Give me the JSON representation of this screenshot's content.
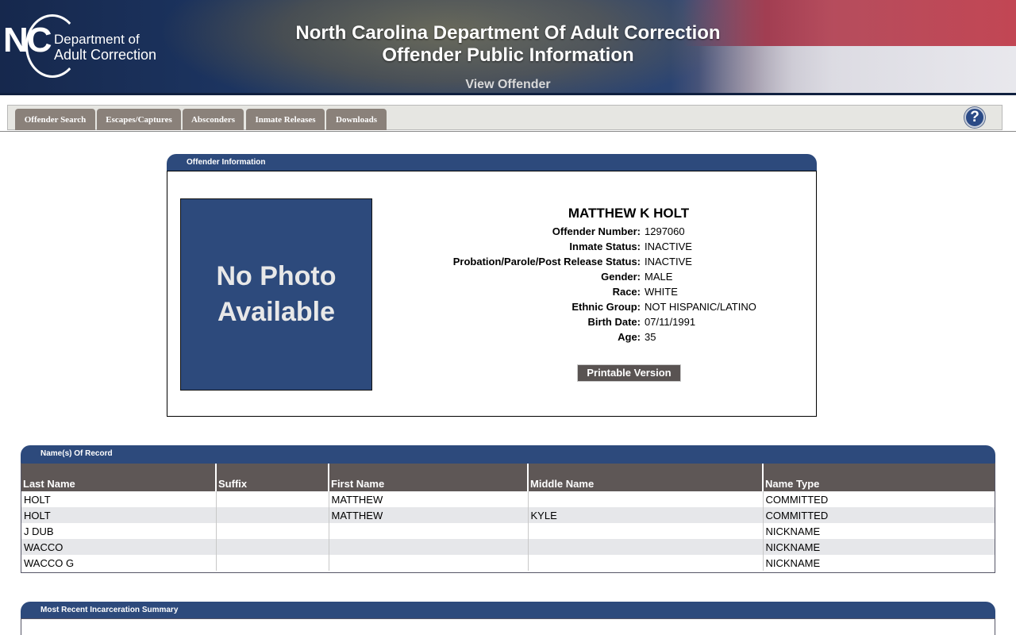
{
  "header": {
    "logo_nc": "NC",
    "logo_line1": "Department of",
    "logo_line2": "Adult Correction",
    "title_line1": "North Carolina Department Of Adult Correction",
    "title_line2": "Offender Public Information",
    "subtitle": "View Offender"
  },
  "nav": {
    "tabs": [
      "Offender Search",
      "Escapes/Captures",
      "Absconders",
      "Inmate Releases",
      "Downloads"
    ],
    "help_label": "?"
  },
  "offender_panel": {
    "heading": "Offender Information",
    "photo_placeholder": "No Photo Available",
    "name": "MATTHEW K HOLT",
    "fields": [
      {
        "label": "Offender Number:",
        "value": "1297060"
      },
      {
        "label": "Inmate Status:",
        "value": "INACTIVE"
      },
      {
        "label": "Probation/Parole/Post Release Status:",
        "value": "INACTIVE"
      },
      {
        "label": "Gender:",
        "value": "MALE"
      },
      {
        "label": "Race:",
        "value": "WHITE"
      },
      {
        "label": "Ethnic Group:",
        "value": "NOT HISPANIC/LATINO"
      },
      {
        "label": "Birth Date:",
        "value": "07/11/1991"
      },
      {
        "label": "Age:",
        "value": "35"
      }
    ],
    "print_button": "Printable Version"
  },
  "names_panel": {
    "heading": "Name(s) Of Record",
    "columns": [
      "Last Name",
      "Suffix",
      "First Name",
      "Middle Name",
      "Name Type"
    ],
    "rows": [
      [
        "HOLT",
        "",
        "MATTHEW",
        "",
        "COMMITTED"
      ],
      [
        "HOLT",
        "",
        "MATTHEW",
        "KYLE",
        "COMMITTED"
      ],
      [
        "J DUB",
        "",
        "",
        "",
        "NICKNAME"
      ],
      [
        "WACCO",
        "",
        "",
        "",
        "NICKNAME"
      ],
      [
        "WACCO G",
        "",
        "",
        "",
        "NICKNAME"
      ]
    ]
  },
  "incarceration_panel": {
    "heading": "Most Recent Incarceration Summary"
  }
}
